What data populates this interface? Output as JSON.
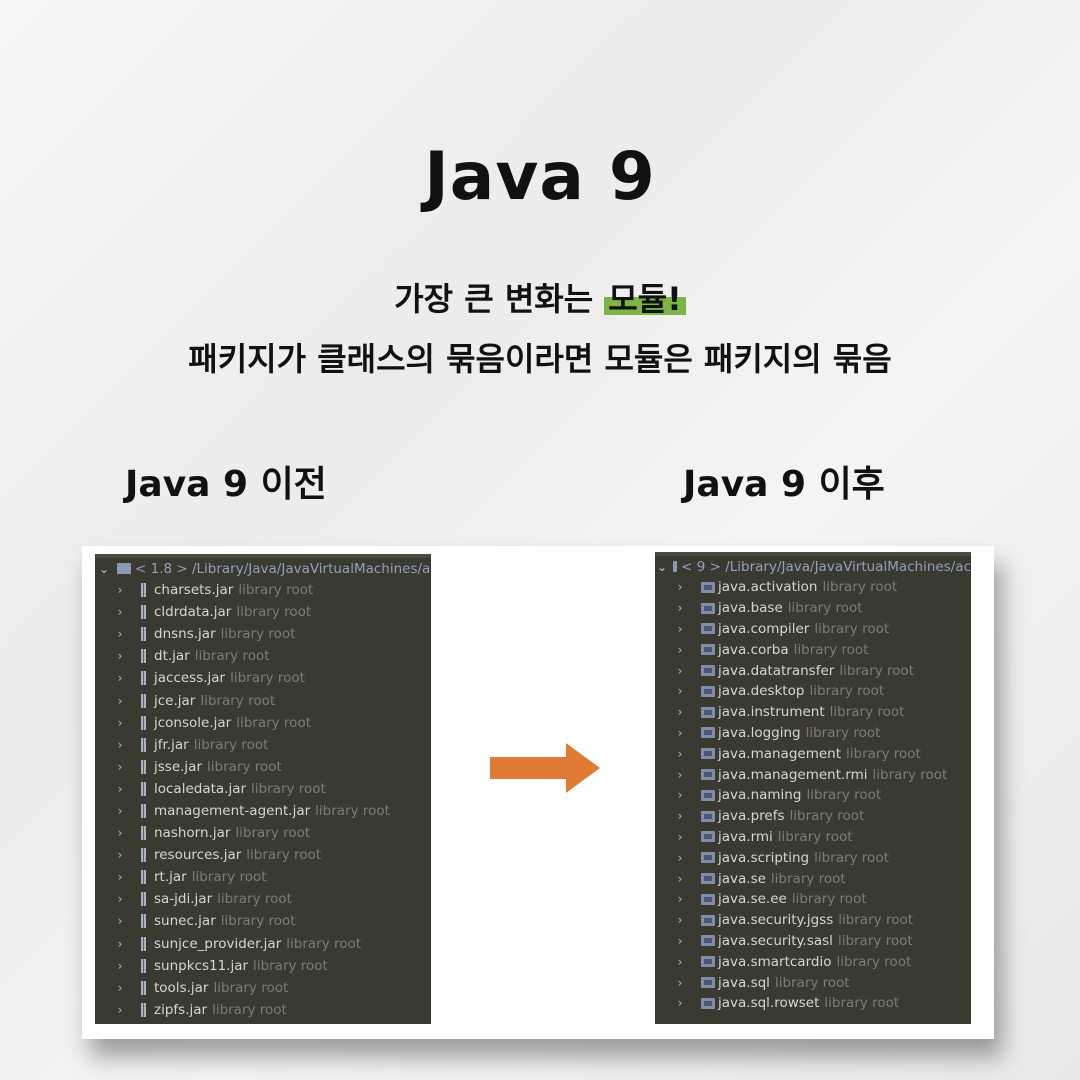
{
  "title": "Java 9",
  "subtitle": {
    "line1_before": "가장 큰 변화는 ",
    "line1_highlight": "모듈!",
    "line2": "패키지가 클래스의 묶음이라면 모듈은 패키지의 묶음"
  },
  "left": {
    "heading": "Java 9 이전",
    "root_label": "< 1.8 > /Library/Java/JavaVirtualMachines/a",
    "library_tag": "library root",
    "items": [
      "charsets.jar",
      "cldrdata.jar",
      "dnsns.jar",
      "dt.jar",
      "jaccess.jar",
      "jce.jar",
      "jconsole.jar",
      "jfr.jar",
      "jsse.jar",
      "localedata.jar",
      "management-agent.jar",
      "nashorn.jar",
      "resources.jar",
      "rt.jar",
      "sa-jdi.jar",
      "sunec.jar",
      "sunjce_provider.jar",
      "sunpkcs11.jar",
      "tools.jar",
      "zipfs.jar"
    ]
  },
  "right": {
    "heading": "Java 9 이후",
    "root_label": "< 9 > /Library/Java/JavaVirtualMachines/ac",
    "library_tag": "library root",
    "items": [
      "java.activation",
      "java.base",
      "java.compiler",
      "java.corba",
      "java.datatransfer",
      "java.desktop",
      "java.instrument",
      "java.logging",
      "java.management",
      "java.management.rmi",
      "java.naming",
      "java.prefs",
      "java.rmi",
      "java.scripting",
      "java.se",
      "java.se.ee",
      "java.security.jgss",
      "java.security.sasl",
      "java.smartcardio",
      "java.sql",
      "java.sql.rowset"
    ]
  },
  "colors": {
    "highlight": "#7db544",
    "arrow": "#e07b35",
    "panel_bg": "#3b3a31"
  },
  "icons": {
    "arrow": "right-arrow-icon",
    "expand": "chevron-right-icon",
    "jar": "jar-icon",
    "module": "module-icon"
  }
}
